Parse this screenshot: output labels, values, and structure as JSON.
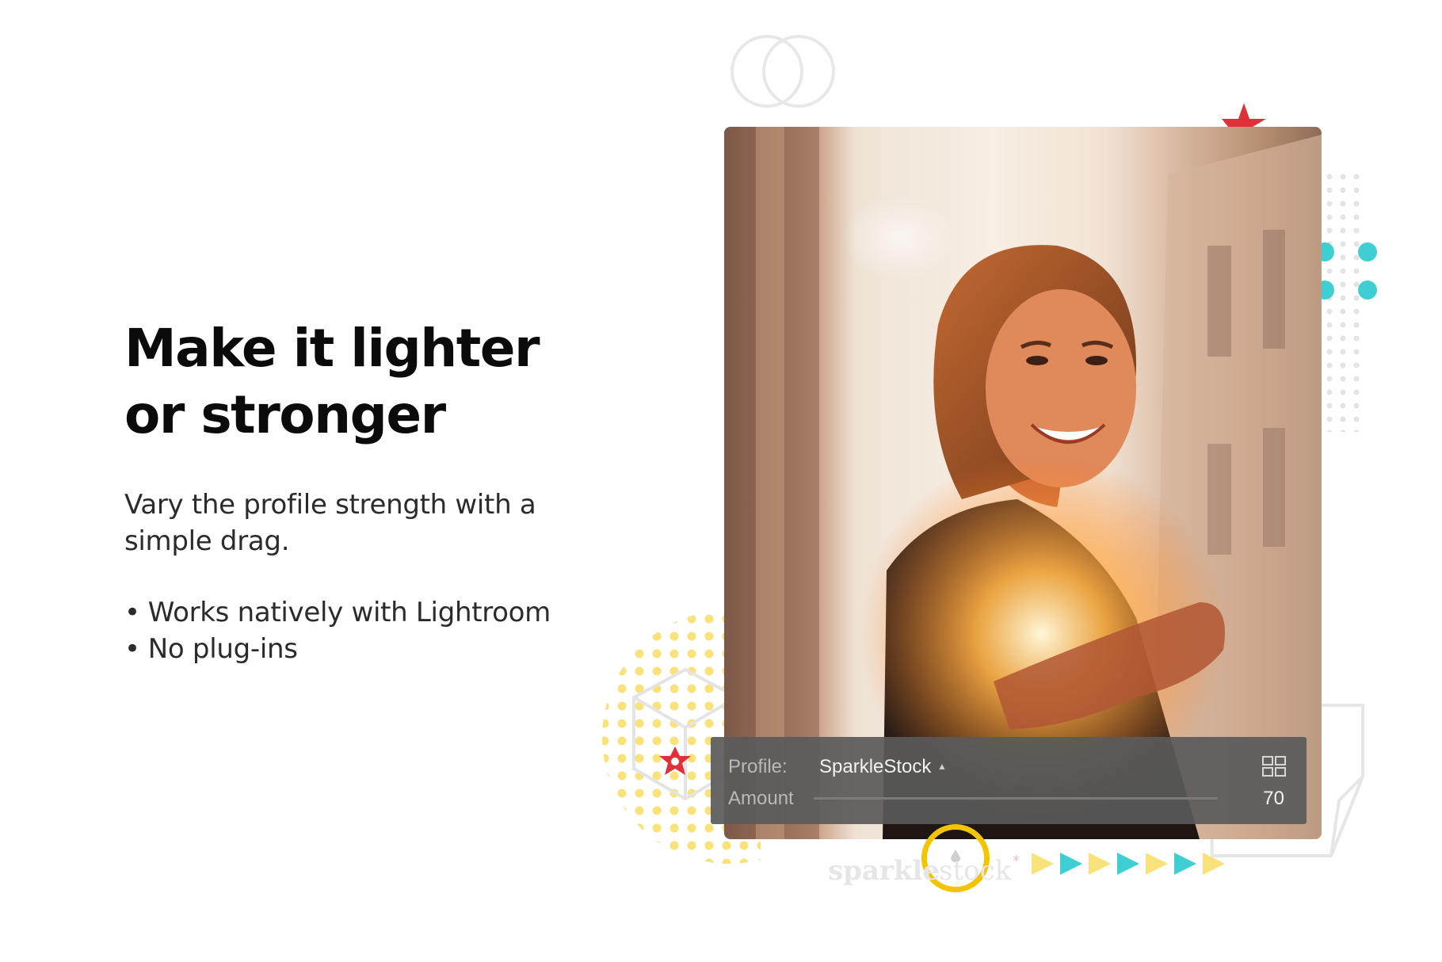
{
  "hero": {
    "headline_line1": "Make it lighter",
    "headline_line2": "or stronger",
    "description": "Vary the profile strength with a simple drag.",
    "bullets": [
      {
        "bullet": "•",
        "text": "Works natively with Lightroom"
      },
      {
        "bullet": "•",
        "text": "No plug-ins"
      }
    ]
  },
  "profile_panel": {
    "profile_label": "Profile:",
    "profile_value": "SparkleStock",
    "amount_label": "Amount",
    "amount_value": "70",
    "amount_fraction": 0.35,
    "icons": [
      "chevron-up-icon",
      "grid-view-icon"
    ]
  },
  "branding": {
    "logo_text_bold": "sparkle",
    "logo_text_light": "stock"
  },
  "colors": {
    "accent_yellow": "#f4c400",
    "accent_teal": "#3fcfd3",
    "accent_red": "#e0303a",
    "dots_yellow": "#f9e27a",
    "panel_bg": "#5a5a5a"
  }
}
